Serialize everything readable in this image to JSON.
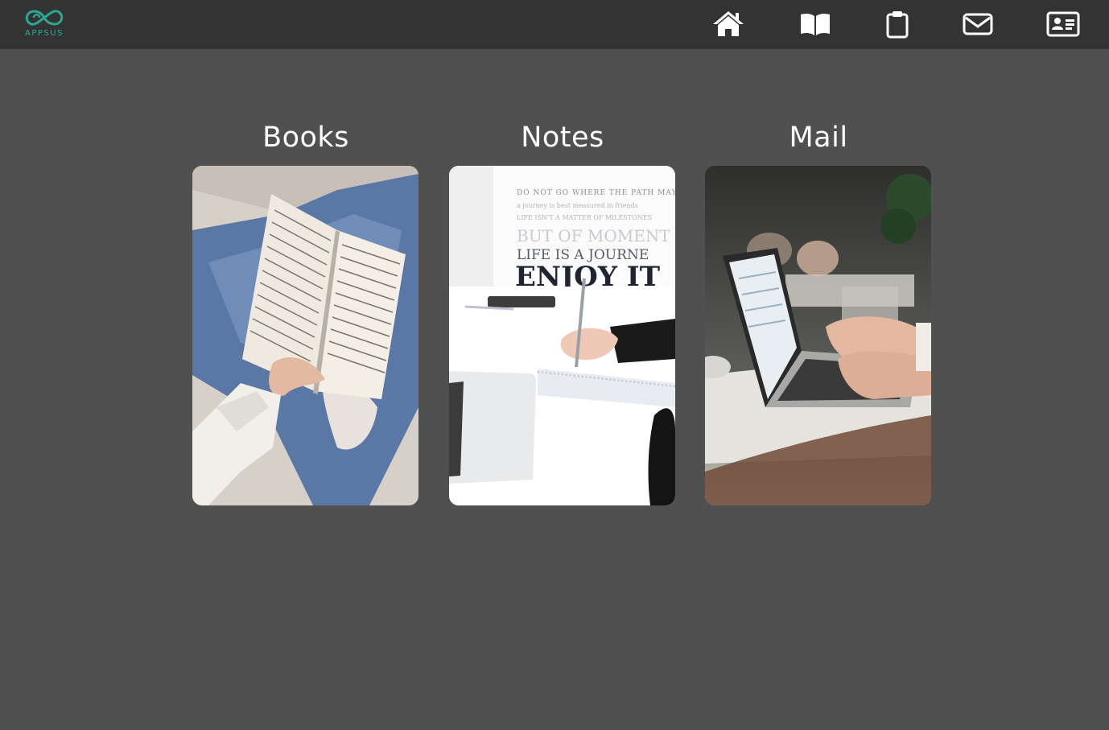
{
  "header": {
    "logo_text": "APPSUS",
    "brand_color": "#2ba893",
    "nav": [
      {
        "name": "home",
        "icon": "home-icon"
      },
      {
        "name": "books",
        "icon": "open-book-icon"
      },
      {
        "name": "notes",
        "icon": "clipboard-icon"
      },
      {
        "name": "mail",
        "icon": "envelope-icon"
      },
      {
        "name": "contacts",
        "icon": "id-card-icon"
      }
    ]
  },
  "apps": [
    {
      "title": "Books",
      "image": "person-reading-open-book-photo"
    },
    {
      "title": "Notes",
      "image": "hand-writing-on-notepad-photo"
    },
    {
      "title": "Mail",
      "image": "hands-typing-on-laptop-photo"
    }
  ],
  "photo_text": {
    "line1": "BUT OF MOMENT",
    "line2": "LIFE IS A JOURNE",
    "line3": "ENJOY IT"
  },
  "colors": {
    "background": "#505050",
    "header": "#333333",
    "text": "#ffffff"
  }
}
